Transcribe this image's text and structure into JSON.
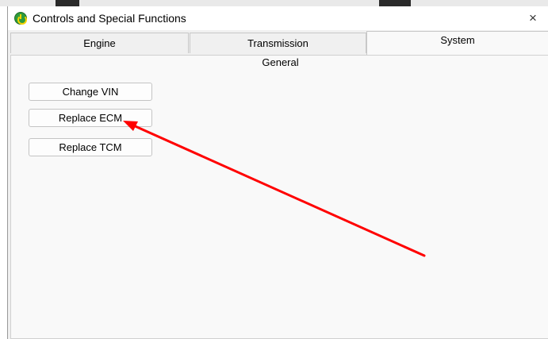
{
  "window": {
    "title": "Controls and Special Functions",
    "close_symbol": "×"
  },
  "tabs": [
    {
      "label": "Engine",
      "active": false
    },
    {
      "label": "Transmission",
      "active": false
    },
    {
      "label": "System",
      "active": true
    }
  ],
  "panel": {
    "group_label": "General",
    "buttons": [
      {
        "label": "Change VIN"
      },
      {
        "label": "Replace ECM"
      },
      {
        "label": "Replace TCM"
      }
    ]
  },
  "annotation": {
    "color": "#ff0000"
  },
  "icons": {
    "app": "app-power-icon",
    "close": "close-icon"
  }
}
